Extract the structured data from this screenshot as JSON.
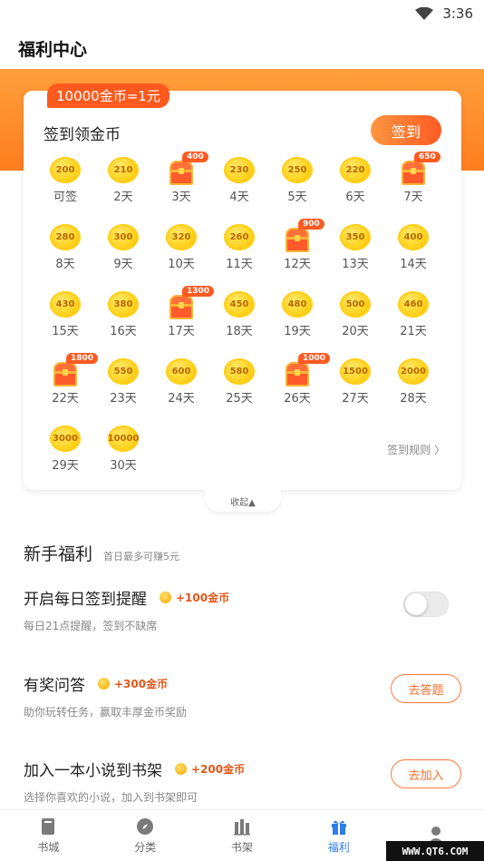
{
  "status_bar": {
    "time": "3:36"
  },
  "header": {
    "title": "福利中心"
  },
  "signin": {
    "rate_badge": "10000金币=1元",
    "title": "签到领金币",
    "sign_button": "签到",
    "rules_link": "签到规则 〉",
    "collapse_label": "收起▲",
    "days": [
      {
        "type": "coin",
        "value": "200",
        "label": "可签"
      },
      {
        "type": "coin",
        "value": "210",
        "label": "2天"
      },
      {
        "type": "chest",
        "value": "400",
        "label": "3天"
      },
      {
        "type": "coin",
        "value": "230",
        "label": "4天"
      },
      {
        "type": "coin",
        "value": "250",
        "label": "5天"
      },
      {
        "type": "coin",
        "value": "220",
        "label": "6天"
      },
      {
        "type": "chest",
        "value": "650",
        "label": "7天"
      },
      {
        "type": "coin",
        "value": "280",
        "label": "8天"
      },
      {
        "type": "coin",
        "value": "300",
        "label": "9天"
      },
      {
        "type": "coin",
        "value": "320",
        "label": "10天"
      },
      {
        "type": "coin",
        "value": "260",
        "label": "11天"
      },
      {
        "type": "chest",
        "value": "900",
        "label": "12天"
      },
      {
        "type": "coin",
        "value": "350",
        "label": "13天"
      },
      {
        "type": "coin",
        "value": "400",
        "label": "14天"
      },
      {
        "type": "coin",
        "value": "430",
        "label": "15天"
      },
      {
        "type": "coin",
        "value": "380",
        "label": "16天"
      },
      {
        "type": "chest",
        "value": "1300",
        "label": "17天"
      },
      {
        "type": "coin",
        "value": "450",
        "label": "18天"
      },
      {
        "type": "coin",
        "value": "480",
        "label": "19天"
      },
      {
        "type": "coin",
        "value": "500",
        "label": "20天"
      },
      {
        "type": "coin",
        "value": "460",
        "label": "21天"
      },
      {
        "type": "chest",
        "value": "1800",
        "label": "22天"
      },
      {
        "type": "coin",
        "value": "550",
        "label": "23天"
      },
      {
        "type": "coin",
        "value": "600",
        "label": "24天"
      },
      {
        "type": "coin",
        "value": "580",
        "label": "25天"
      },
      {
        "type": "chest",
        "value": "1000",
        "label": "26天"
      },
      {
        "type": "coin",
        "value": "1500",
        "label": "27天"
      },
      {
        "type": "coin",
        "value": "2000",
        "label": "28天"
      },
      {
        "type": "coin",
        "value": "3000",
        "label": "29天"
      },
      {
        "type": "coin",
        "value": "10000",
        "label": "30天"
      }
    ]
  },
  "newbie": {
    "title": "新手福利",
    "subtitle": "首日最多可赚5元",
    "tasks": [
      {
        "name": "开启每日签到提醒",
        "reward": "+100金币",
        "desc": "每日21点提醒，签到不缺席",
        "control": "toggle",
        "toggle_on": false
      },
      {
        "name": "有奖问答",
        "reward": "+300金币",
        "desc": "助你玩转任务，赢取丰厚金币奖励",
        "control": "button",
        "button": "去答题"
      },
      {
        "name": "加入一本小说到书架",
        "reward": "+200金币",
        "desc": "选择你喜欢的小说，加入到书架即可",
        "control": "button",
        "button": "去加入"
      }
    ]
  },
  "tabbar": {
    "tabs": [
      {
        "label": "书城",
        "icon": "book-icon"
      },
      {
        "label": "分类",
        "icon": "compass-icon"
      },
      {
        "label": "书架",
        "icon": "bookshelf-icon"
      },
      {
        "label": "福利",
        "icon": "gift-icon",
        "active": true
      },
      {
        "label": "",
        "icon": "user-icon"
      }
    ]
  },
  "watermark": "WWW.QT6.COM",
  "colors": {
    "accent": "#ff7d1e",
    "active_tab": "#2f7ee8",
    "reward_text": "#e0571a"
  }
}
